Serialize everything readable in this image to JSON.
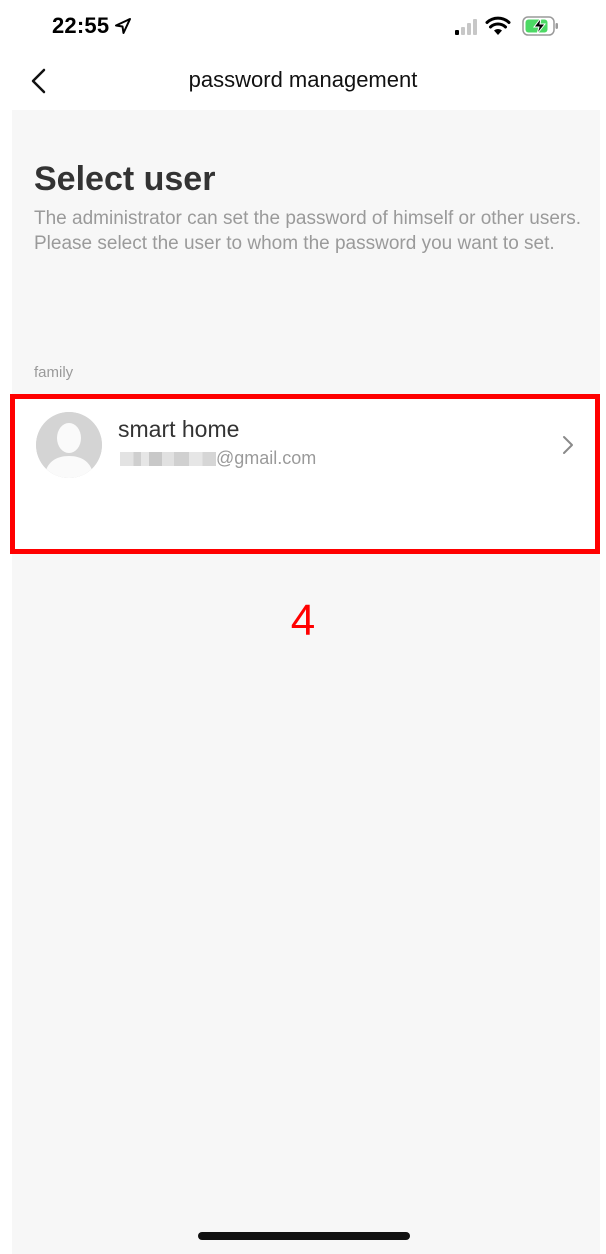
{
  "status_bar": {
    "time": "22:55"
  },
  "nav": {
    "title": "password management"
  },
  "page": {
    "heading": "Select user",
    "description": "The administrator can set the password of himself or other users. Please select the user to whom the password you want to set."
  },
  "section": {
    "label": "family"
  },
  "user": {
    "name": "smart home",
    "email": "@gmail.com"
  },
  "annotation": {
    "step": "4",
    "color": "#ff0000"
  },
  "icons": {
    "back": "chevron-left-icon",
    "row_arrow": "chevron-right-icon",
    "avatar": "person-silhouette"
  }
}
